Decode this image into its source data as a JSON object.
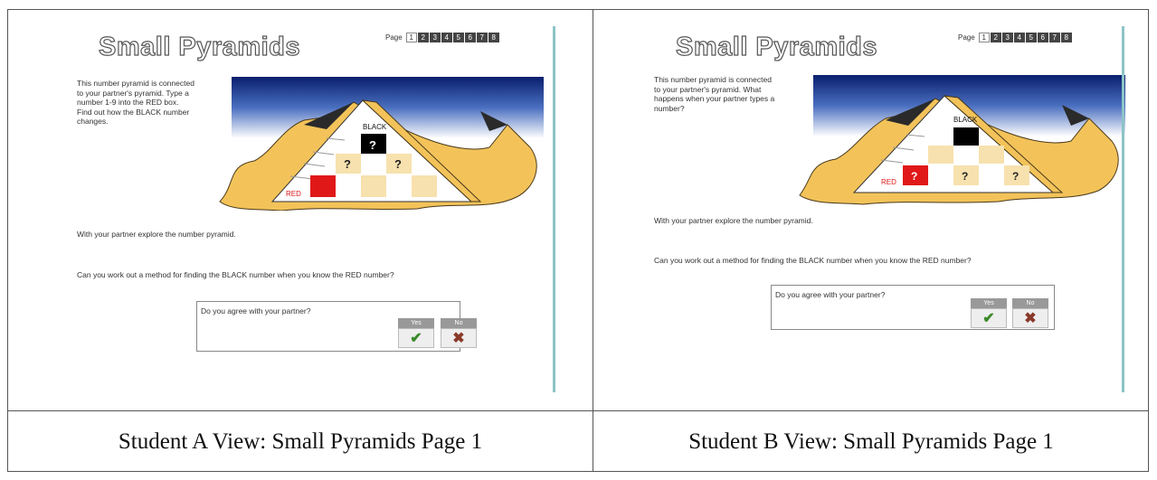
{
  "panel_a": {
    "title": "Small Pyramids",
    "pager_label": "Page",
    "pages": [
      "1",
      "2",
      "3",
      "4",
      "5",
      "6",
      "7",
      "8"
    ],
    "instructions": "This number pyramid is connected to your partner's pyramid. Type a number 1-9 into the RED box. Find out how the BLACK number changes.",
    "black_label": "BLACK",
    "red_label": "RED",
    "black_value": "?",
    "middle_values": [
      "?",
      "?"
    ],
    "explore_text": "With your partner explore the number pyramid.",
    "question_text": "Can you work out a method for finding the BLACK number when you know the RED number?",
    "agree_question": "Do you agree with your partner?",
    "yes_label": "Yes",
    "no_label": "No",
    "yes_glyph": "✔",
    "no_glyph": "✖",
    "caption": "Student A View: Small Pyramids Page 1"
  },
  "panel_b": {
    "title": "Small Pyramids",
    "pager_label": "Page",
    "pages": [
      "1",
      "2",
      "3",
      "4",
      "5",
      "6",
      "7",
      "8"
    ],
    "instructions": "This number pyramid is connected to your partner's pyramid. What happens when your partner types a number?",
    "black_label": "BLACK",
    "red_label": "RED",
    "red_value": "?",
    "bottom_values": [
      "?",
      "?"
    ],
    "explore_text": "With your partner explore the number pyramid.",
    "question_text": "Can you work out a method for finding the BLACK number when you know the RED number?",
    "agree_question": "Do you agree with your partner?",
    "yes_label": "Yes",
    "no_label": "No",
    "yes_glyph": "✔",
    "no_glyph": "✖",
    "caption": "Student B View: Small Pyramids Page 1"
  },
  "colors": {
    "sky_top": "#0a1f6e",
    "sky_bottom": "#ffffff",
    "sand": "#f3c35a",
    "sand_outline": "#4a3a1a",
    "pyramid_face": "#ffffff",
    "cell_light": "#f7e1ae",
    "red_box": "#e01818",
    "black_box": "#000000",
    "accent_line": "#8cc4c6"
  }
}
